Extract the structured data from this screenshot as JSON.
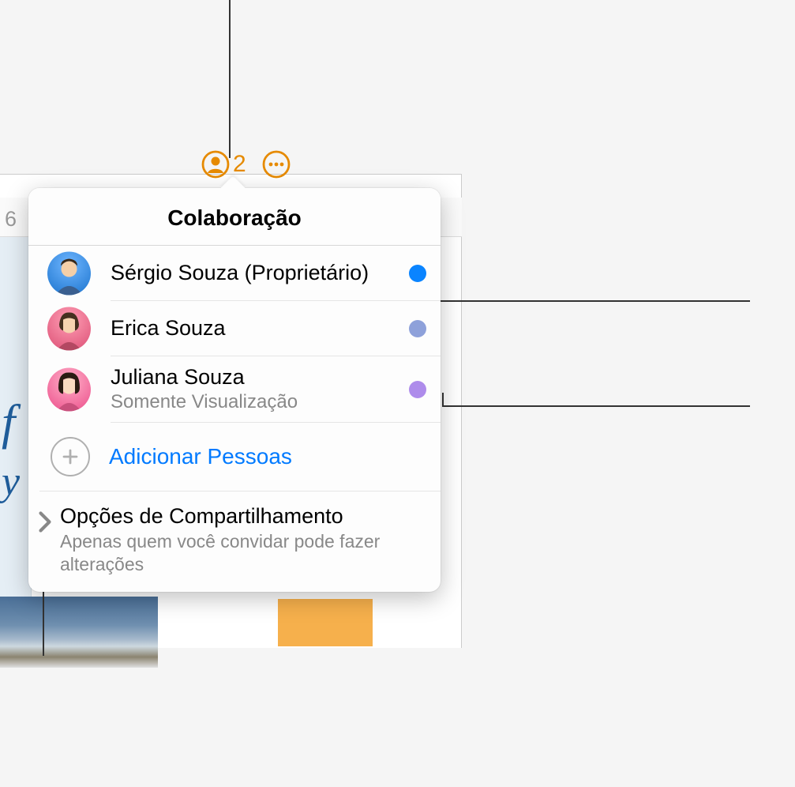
{
  "toolbar": {
    "collab_count": "2"
  },
  "bg": {
    "six": "6",
    "f_italic": "f",
    "y_italic": "y"
  },
  "popover": {
    "title": "Colaboração",
    "people": [
      {
        "name": "Sérgio Souza (Proprietário)",
        "sub": "",
        "dot_color": "#0a84ff"
      },
      {
        "name": "Erica Souza",
        "sub": "",
        "dot_color": "#7a91d4"
      },
      {
        "name": "Juliana Souza",
        "sub": "Somente Visualização",
        "dot_color": "#9a6fe6"
      }
    ],
    "add_label": "Adicionar Pessoas",
    "share_title": "Opções de Compartilhamento",
    "share_sub": "Apenas quem você convidar pode fazer alterações"
  }
}
